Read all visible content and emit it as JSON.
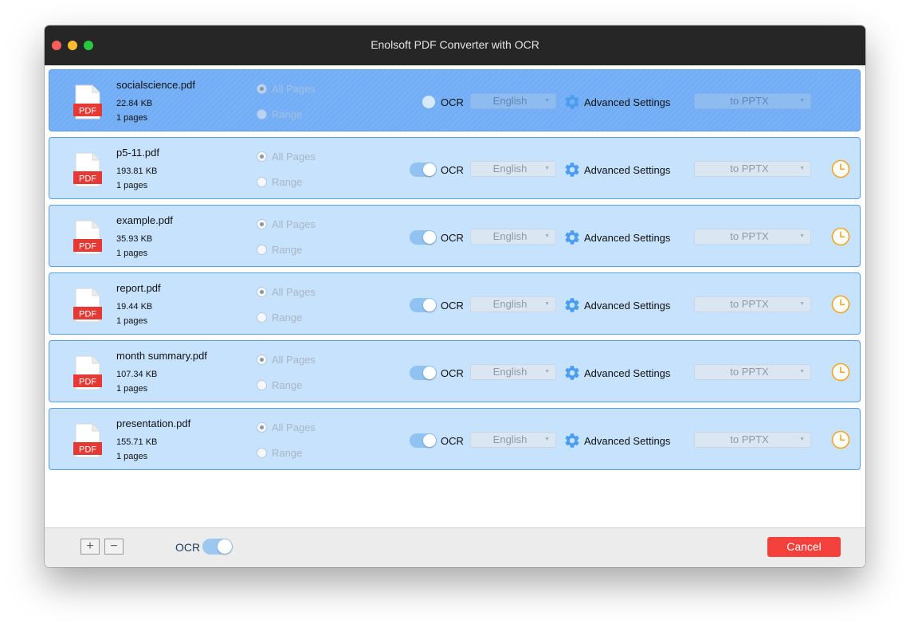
{
  "window": {
    "title": "Enolsoft PDF Converter with OCR"
  },
  "range_options": {
    "all_pages": "All Pages",
    "range": "Range"
  },
  "controls": {
    "ocr_label": "OCR",
    "advanced_label": "Advanced Settings",
    "file_type_badge": "PDF"
  },
  "files": [
    {
      "name": "socialscience.pdf",
      "size": "22.84 KB",
      "pages": "1 pages",
      "language": "English",
      "format": "to PPTX",
      "ocr_enabled": false,
      "selected": true,
      "status_icon": "none"
    },
    {
      "name": "p5-11.pdf",
      "size": "193.81 KB",
      "pages": "1 pages",
      "language": "English",
      "format": "to PPTX",
      "ocr_enabled": true,
      "selected": false,
      "status_icon": "clock-icon"
    },
    {
      "name": "example.pdf",
      "size": "35.93 KB",
      "pages": "1 pages",
      "language": "English",
      "format": "to PPTX",
      "ocr_enabled": true,
      "selected": false,
      "status_icon": "clock-icon"
    },
    {
      "name": "report.pdf",
      "size": "19.44 KB",
      "pages": "1 pages",
      "language": "English",
      "format": "to PPTX",
      "ocr_enabled": true,
      "selected": false,
      "status_icon": "clock-icon"
    },
    {
      "name": "month summary.pdf",
      "size": "107.34 KB",
      "pages": "1 pages",
      "language": "English",
      "format": "to PPTX",
      "ocr_enabled": true,
      "selected": false,
      "status_icon": "clock-icon"
    },
    {
      "name": "presentation.pdf",
      "size": "155.71 KB",
      "pages": "1 pages",
      "language": "English",
      "format": "to PPTX",
      "ocr_enabled": true,
      "selected": false,
      "status_icon": "clock-icon"
    }
  ],
  "bottom_bar": {
    "add_label": "+",
    "remove_label": "−",
    "ocr_label": "OCR",
    "ocr_enabled": true,
    "cancel_label": "Cancel"
  },
  "colors": {
    "row_background": "#c6e2fd",
    "row_selected_background": "#72adf6",
    "row_border": "#5a9ce6",
    "accent_blue": "#4a9df0",
    "pdf_red": "#e53935",
    "clock_orange": "#f5a623",
    "cancel_red": "#f4413b"
  }
}
